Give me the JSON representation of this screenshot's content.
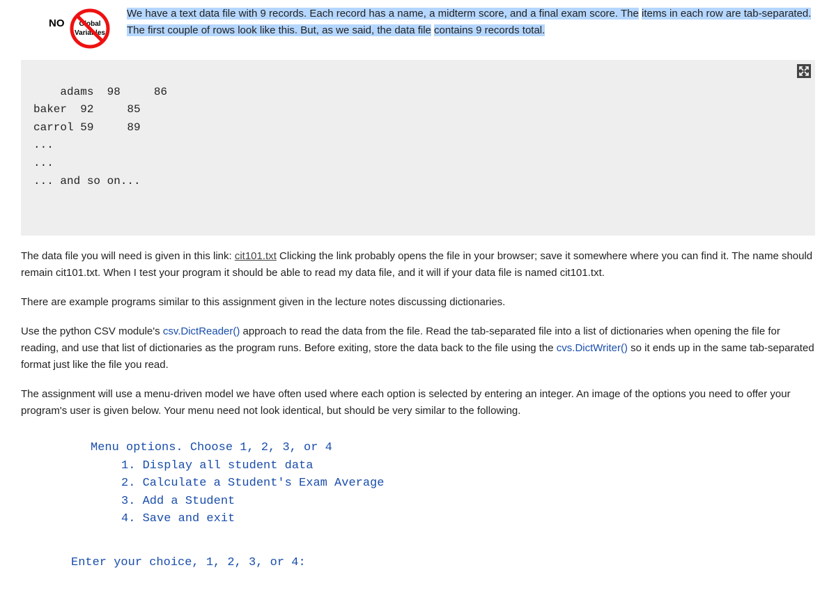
{
  "badge": {
    "no_text": "NO",
    "inner_top": "Global",
    "inner_bottom": "Variables",
    "name": "no-globals-icon"
  },
  "intro": {
    "highlighted_part1": "We have a text data file with 9 records. Each record has a name, a midterm score, and a final exam score. The",
    "plain_part1": " ",
    "highlighted_part2": "items in each row are tab-separated. The first couple of rows look like this. But, as we said, the data file",
    "plain_part2": " ",
    "highlighted_part3": "contains 9 records total.",
    "plain_part3": ""
  },
  "sample_data": "adams  98     86\nbaker  92     85\ncarrol 59     89\n...\n...\n... and so on...",
  "expand_icon_name": "expand-icon",
  "p2": {
    "pre": "The data file you will need is given in this link: ",
    "link_text": "cit101.txt",
    "post": "    Clicking the link probably opens the file in your browser; save it somewhere where you can find it. The name should remain cit101.txt. When I test your program it should be able to read my data file, and it will if your data file is named cit101.txt."
  },
  "p3": "There are example programs similar to this assignment given in the lecture notes discussing dictionaries.",
  "p4": {
    "a": "Use the python CSV module's ",
    "ref1": "csv.DictReader()",
    "b": " approach to read the data from the file. Read the tab-separated file into a list of dictionaries when opening the file for reading, and use that list of dictionaries as the program runs. Before exiting, store the data back to the file using the ",
    "ref2": "cvs.DictWriter()",
    "c": " so it ends up in the same tab-separated format just like the file you read."
  },
  "p5": "The assignment will use a menu-driven model we have often used where each option is selected by entering an integer. An image of the options you need to offer your program's user is given below. Your menu need not look identical, but should be very similar to the following.",
  "menu": {
    "header": "Menu options.  Choose 1, 2, 3, or 4",
    "opt1": "1. Display all student data",
    "opt2": "2. Calculate a Student's Exam Average",
    "opt3": "3. Add a Student",
    "opt4": "4. Save and exit",
    "prompt": "Enter your choice, 1, 2, 3, or 4:"
  }
}
